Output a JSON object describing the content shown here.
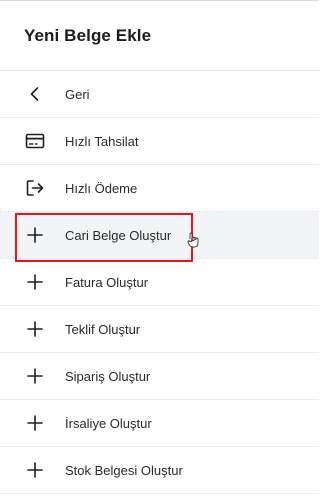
{
  "header": {
    "title": "Yeni Belge Ekle"
  },
  "menu": {
    "items": [
      {
        "label": "Geri",
        "icon": "chevron-left-icon"
      },
      {
        "label": "Hızlı Tahsilat",
        "icon": "credit-card-icon"
      },
      {
        "label": "Hızlı Ödeme",
        "icon": "logout-arrow-icon"
      },
      {
        "label": "Cari Belge Oluştur",
        "icon": "plus-icon"
      },
      {
        "label": "Fatura Oluştur",
        "icon": "plus-icon"
      },
      {
        "label": "Teklif Oluştur",
        "icon": "plus-icon"
      },
      {
        "label": "Sipariş Oluştur",
        "icon": "plus-icon"
      },
      {
        "label": "İrsaliye Oluştur",
        "icon": "plus-icon"
      },
      {
        "label": "Stok Belgesi Oluştur",
        "icon": "plus-icon"
      }
    ]
  },
  "colors": {
    "highlight": "#e8141b",
    "hover_bg": "#f3f4f5"
  }
}
